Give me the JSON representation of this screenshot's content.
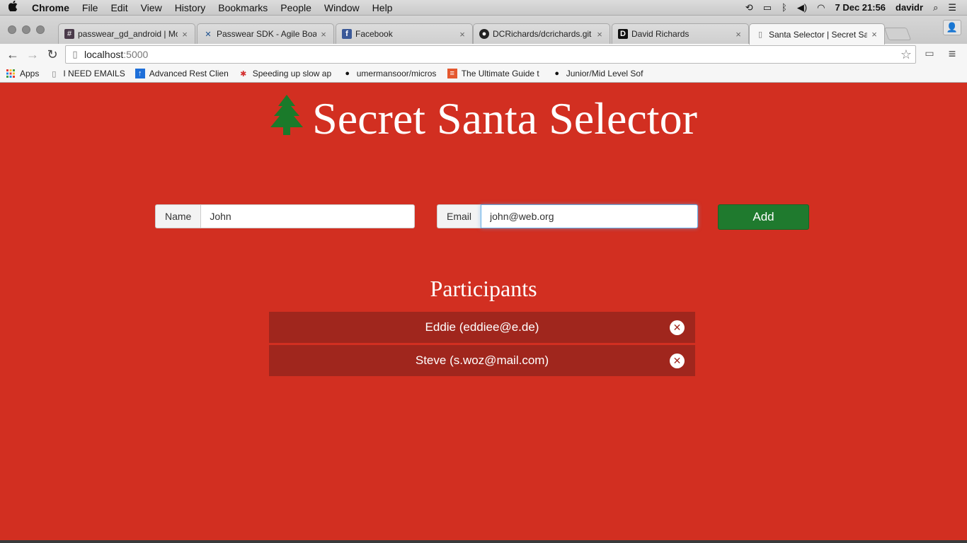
{
  "macos_menubar": {
    "app_name": "Chrome",
    "menus": [
      "File",
      "Edit",
      "View",
      "History",
      "Bookmarks",
      "People",
      "Window",
      "Help"
    ],
    "date_time": "7 Dec  21:56",
    "user": "davidr"
  },
  "browser": {
    "tabs": [
      {
        "title": "passwear_gd_android | Mo",
        "icon": "hash-icon",
        "active": false
      },
      {
        "title": "Passwear SDK - Agile Boa",
        "icon": "jira-icon",
        "active": false
      },
      {
        "title": "Facebook",
        "icon": "facebook-icon",
        "active": false
      },
      {
        "title": "DCRichards/dcrichards.git",
        "icon": "github-icon",
        "active": false
      },
      {
        "title": "David Richards",
        "icon": "d-icon",
        "active": false
      },
      {
        "title": "Santa Selector | Secret Sa",
        "icon": "page-icon",
        "active": true
      }
    ],
    "address": {
      "host": "localhost",
      "port": ":5000"
    },
    "bookmarks": [
      {
        "label": "Apps",
        "icon": "apps-grid-icon"
      },
      {
        "label": "I NEED EMAILS",
        "icon": "page-icon"
      },
      {
        "label": "Advanced Rest Clien",
        "icon": "arrow-up-icon"
      },
      {
        "label": "Speeding up slow ap",
        "icon": "crab-icon"
      },
      {
        "label": "umermansoor/micros",
        "icon": "github-icon"
      },
      {
        "label": "The Ultimate Guide t",
        "icon": "stack-icon"
      },
      {
        "label": "Junior/Mid Level Sof",
        "icon": "github-icon"
      }
    ]
  },
  "page": {
    "title": "Secret Santa Selector",
    "form": {
      "name_label": "Name",
      "name_value": "John",
      "email_label": "Email",
      "email_value": "john@web.org",
      "add_label": "Add"
    },
    "participants_title": "Participants",
    "participants": [
      {
        "text": "Eddie (eddiee@e.de)"
      },
      {
        "text": "Steve (s.woz@mail.com)"
      }
    ],
    "colors": {
      "background": "#d22f21",
      "row": "#a0261d",
      "add_button": "#1f7a2e",
      "tree": "#1a7a2a"
    }
  }
}
